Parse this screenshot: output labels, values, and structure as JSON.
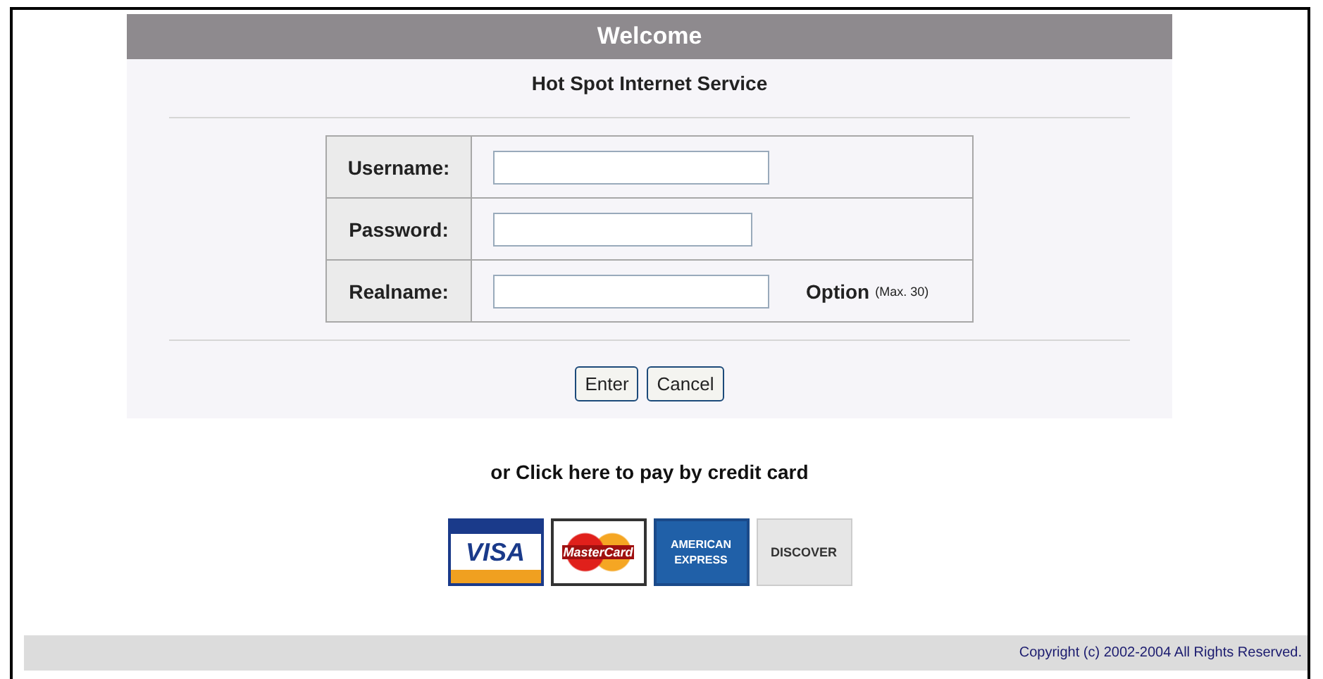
{
  "header": {
    "title": "Welcome",
    "subtitle": "Hot Spot Internet Service"
  },
  "fields": [
    {
      "label": "Username:",
      "kind": "text"
    },
    {
      "label": "Password:",
      "kind": "password"
    },
    {
      "label": "Realname:",
      "kind": "text",
      "note": "Option",
      "note_small": "(Max. 30)"
    }
  ],
  "buttons": [
    "Enter",
    "Cancel"
  ],
  "payment_link": "or Click here to pay by credit card",
  "cards": [
    {
      "kind": "visa",
      "text": "VISA"
    },
    {
      "kind": "mastercard",
      "text": "MasterCard"
    },
    {
      "kind": "amex",
      "text": "AMERICAN EXPRESS"
    },
    {
      "kind": "discover",
      "text": "DISCOVER"
    }
  ],
  "footer": "Copyright (c) 2002-2004 All Rights Reserved."
}
